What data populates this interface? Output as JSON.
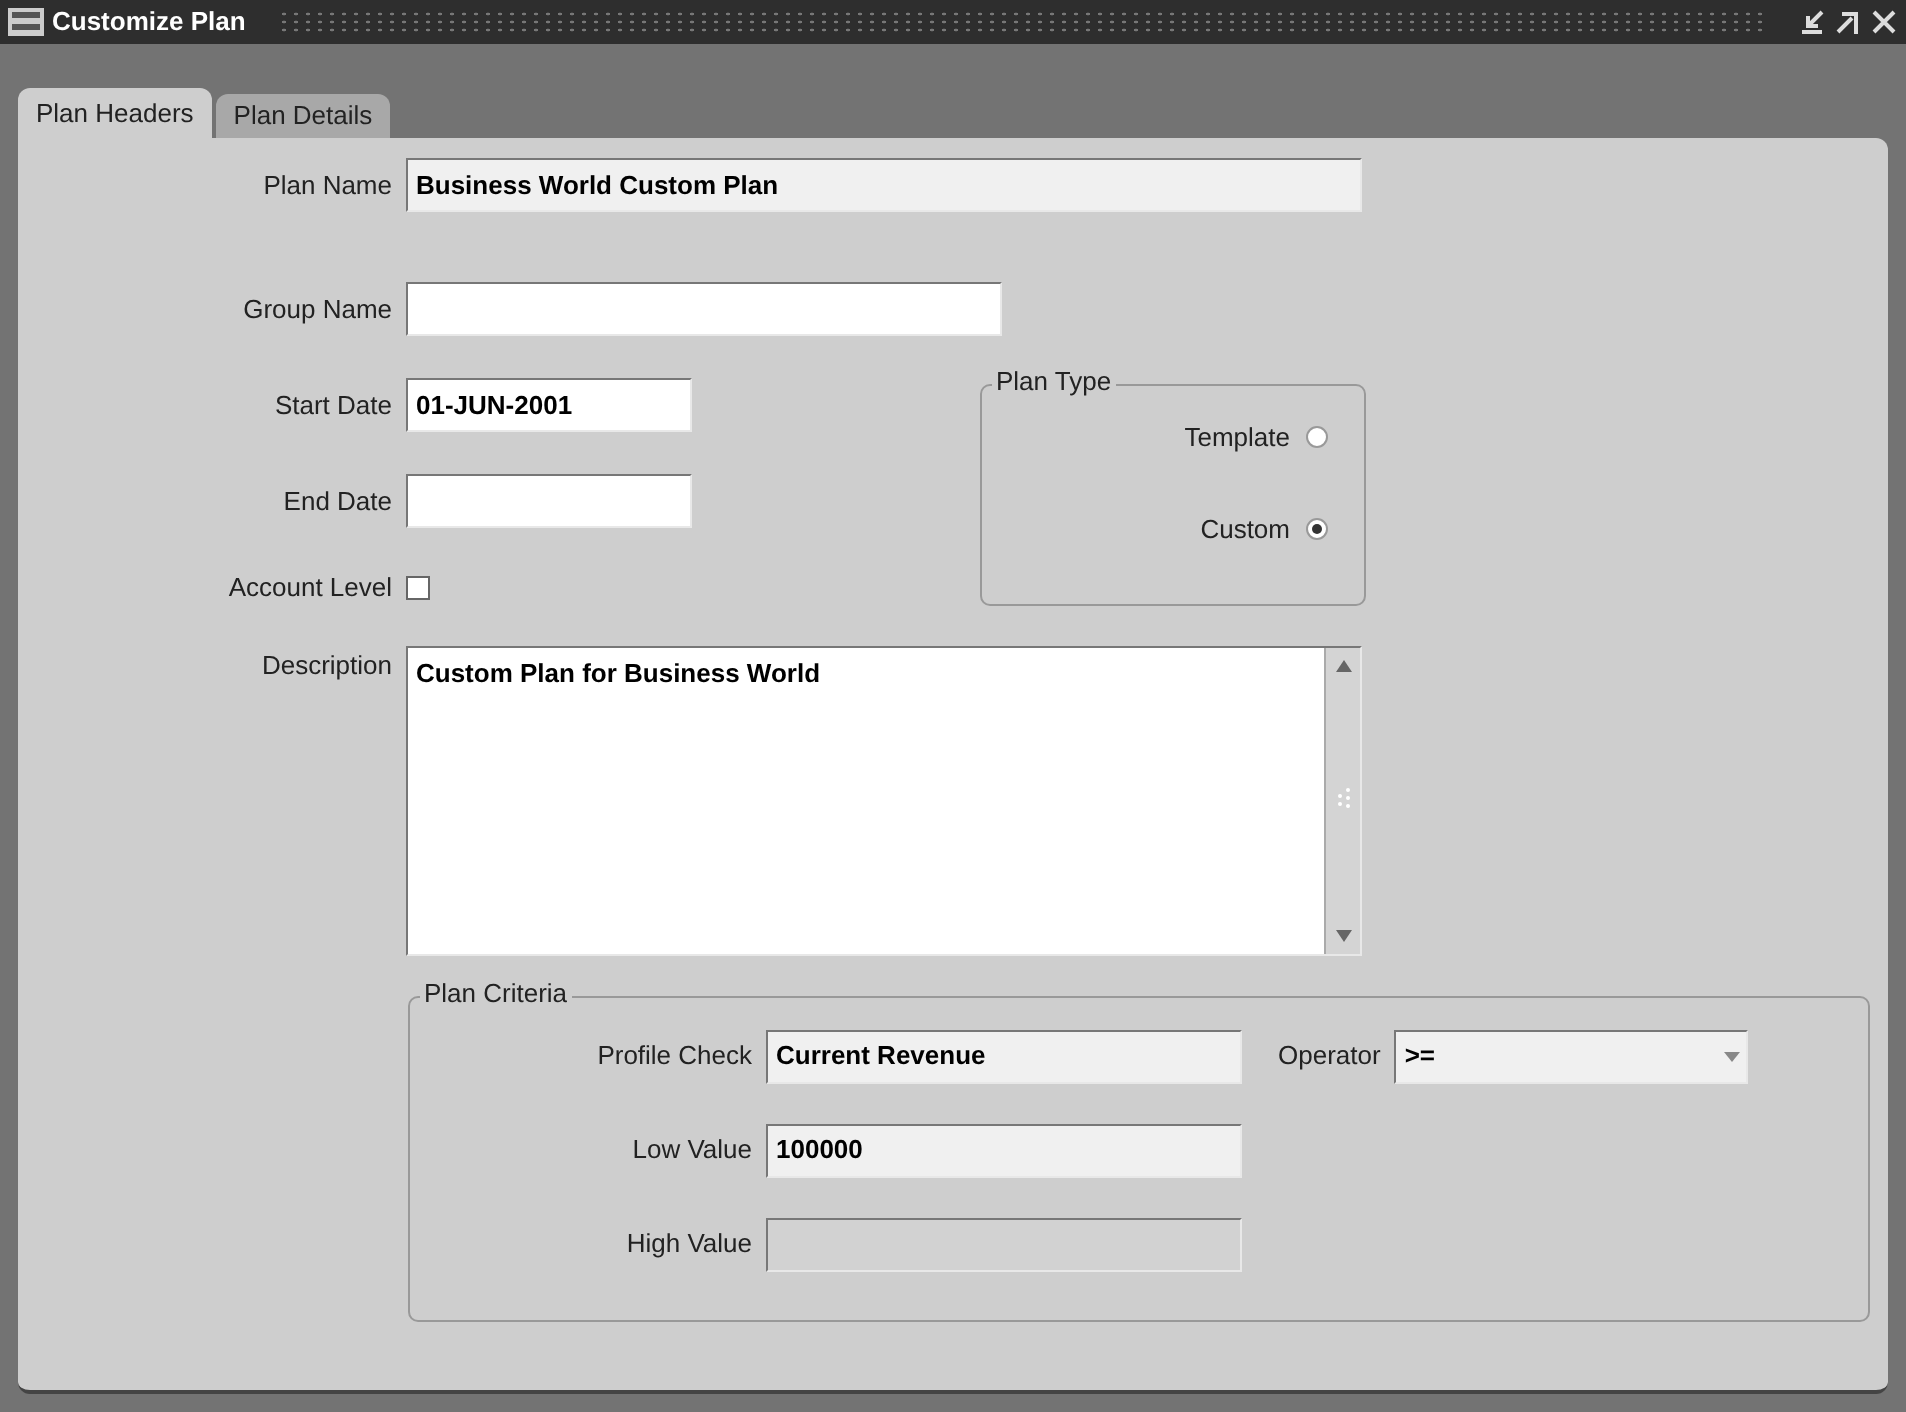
{
  "window": {
    "title": "Customize Plan"
  },
  "tabs": [
    {
      "label": "Plan Headers",
      "selected": true
    },
    {
      "label": "Plan Details",
      "selected": false
    }
  ],
  "header_fields": [
    {
      "label": "Plan Name",
      "value": "Business World Custom Plan",
      "readonly": true
    },
    {
      "label": "Group Name",
      "readonly": false
    },
    {
      "label": "Start Date",
      "value": "01-JUN-2001",
      "readonly": false
    },
    {
      "label": "End Date",
      "readonly": false
    }
  ],
  "account_level": {
    "label": "Account Level",
    "checked": false
  },
  "plan_type": {
    "title": "Plan Type",
    "options": [
      {
        "label": "Template",
        "selected": false
      },
      {
        "label": "Custom",
        "selected": true
      }
    ]
  },
  "description": {
    "label": "Description",
    "value": "Custom Plan for Business World"
  },
  "plan_criteria": {
    "title": "Plan Criteria",
    "fields": [
      {
        "label": "Profile Check",
        "value": "Current Revenue",
        "disabled": false
      },
      {
        "label": "Low Value",
        "value": "100000",
        "disabled": false
      },
      {
        "label": "High Value",
        "disabled": true
      }
    ],
    "operator": {
      "label": "Operator",
      "value": ">="
    }
  }
}
